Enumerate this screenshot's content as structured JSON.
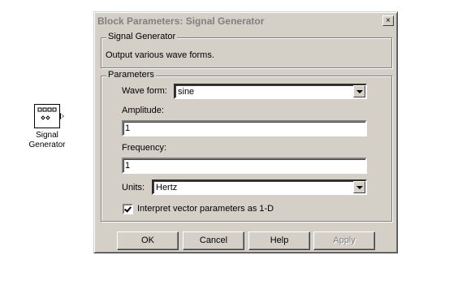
{
  "block": {
    "name": "Signal\nGenerator",
    "icon": "signal-generator-block-icon"
  },
  "dialog": {
    "title": "Block Parameters: Signal Generator",
    "close_label": "×",
    "description_group": {
      "label": "Signal Generator",
      "text": "Output various wave forms."
    },
    "params_group": {
      "label": "Parameters",
      "wave_form": {
        "label": "Wave form:",
        "value": "sine"
      },
      "amplitude": {
        "label": "Amplitude:",
        "value": "1"
      },
      "frequency": {
        "label": "Frequency:",
        "value": "1"
      },
      "units": {
        "label": "Units:",
        "value": "Hertz"
      },
      "interpret_vector": {
        "label": "Interpret vector parameters as 1-D",
        "checked": true
      }
    },
    "buttons": {
      "ok": "OK",
      "cancel": "Cancel",
      "help": "Help",
      "apply": "Apply"
    }
  }
}
